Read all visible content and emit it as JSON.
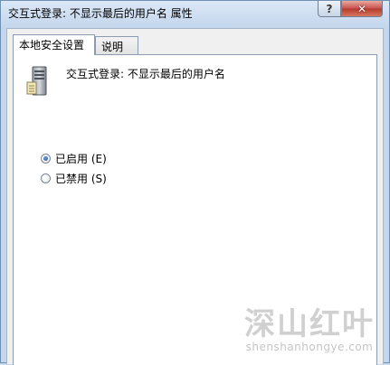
{
  "window": {
    "title": "交互式登录: 不显示最后的用户名 属性",
    "help_label": "?",
    "close_label": "✕"
  },
  "tabs": [
    {
      "label": "本地安全设置",
      "active": true
    },
    {
      "label": "说明",
      "active": false
    }
  ],
  "panel": {
    "policy_icon": "server-icon",
    "policy_name": "交互式登录: 不显示最后的用户名",
    "options": [
      {
        "label": "已启用 (E)",
        "checked": true
      },
      {
        "label": "已禁用 (S)",
        "checked": false
      }
    ]
  },
  "watermark": {
    "main": "深山红叶",
    "sub": "shenshanhongye.com"
  }
}
